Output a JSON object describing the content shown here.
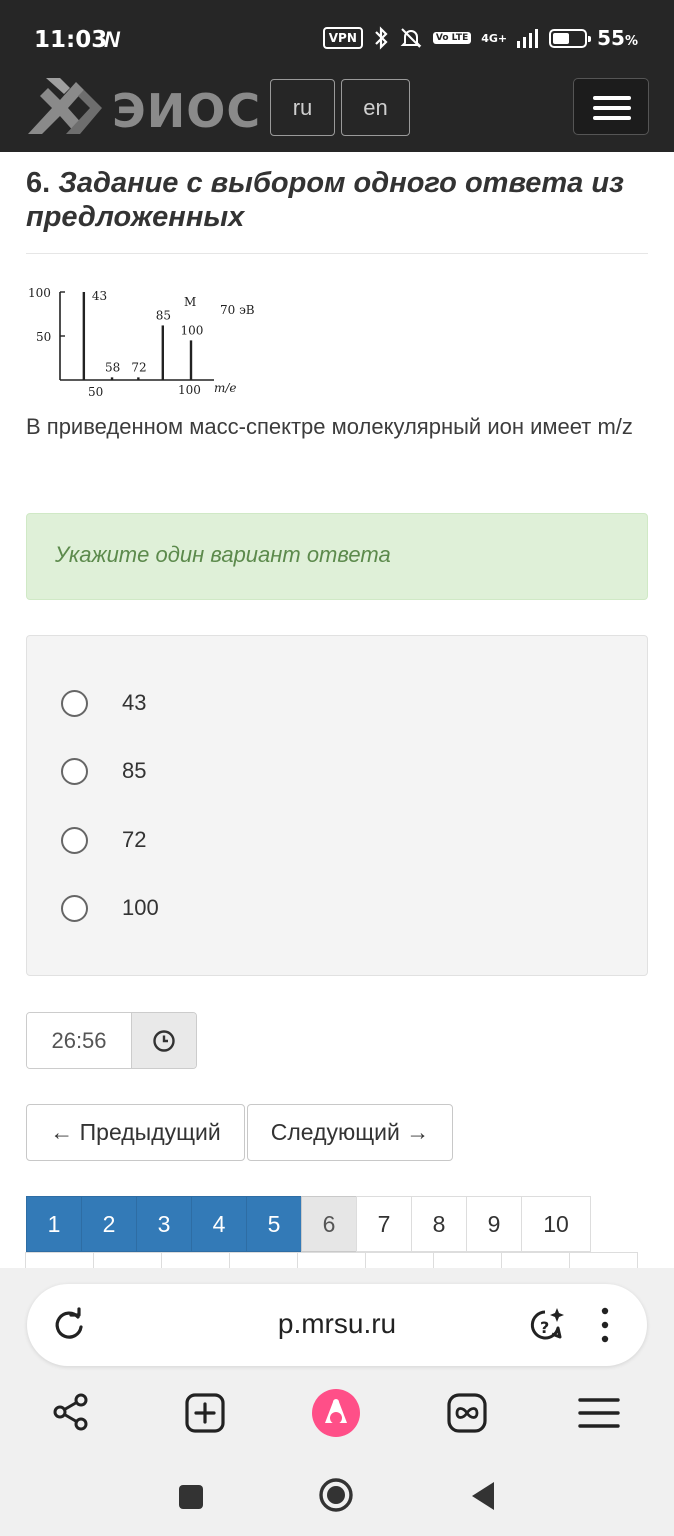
{
  "status_bar": {
    "time": "11:03",
    "nfc": "N",
    "vpn": "VPN",
    "volte": "Vo LTE",
    "network": "4G+",
    "battery": "55",
    "battery_unit": "%"
  },
  "header": {
    "brand": "ЭИОС",
    "languages": [
      "ru",
      "en"
    ]
  },
  "question": {
    "number": "6.",
    "title": "Задание с выбором одного ответа из предложенных",
    "text": "В приведенном масс-спектре молекулярный ион имеет m/z",
    "spectrum": {
      "y_ticks": [
        "100",
        "50"
      ],
      "x_ticks": [
        "50",
        "100"
      ],
      "x_unit": "m/e",
      "energy": "70 эВ",
      "molecular_marker": "M",
      "peaks": [
        {
          "label": "43",
          "mz": 43,
          "intensity": 100
        },
        {
          "label": "58",
          "mz": 58,
          "intensity": 3
        },
        {
          "label": "72",
          "mz": 72,
          "intensity": 3
        },
        {
          "label": "85",
          "mz": 85,
          "intensity": 62
        },
        {
          "label": "100",
          "mz": 100,
          "intensity": 45
        }
      ]
    }
  },
  "hint": "Укажите один вариант ответа",
  "options": [
    "43",
    "85",
    "72",
    "100"
  ],
  "timer": {
    "value": "26:56",
    "icon": "clock-icon"
  },
  "navigation": {
    "prev": "← Предыдущий",
    "next": "Следующий →"
  },
  "pagination": {
    "pages": [
      "1",
      "2",
      "3",
      "4",
      "5",
      "6",
      "7",
      "8",
      "9",
      "10"
    ],
    "answered": [
      "1",
      "2",
      "3",
      "4",
      "5"
    ],
    "current": "6"
  },
  "browser": {
    "url": "p.mrsu.ru"
  },
  "colors": {
    "header_bg": "#262626",
    "hint_bg": "#dff0d8",
    "hint_text": "#5c8a4c",
    "page_answered": "#337ab7",
    "alice_accent": "#ff4f88"
  }
}
